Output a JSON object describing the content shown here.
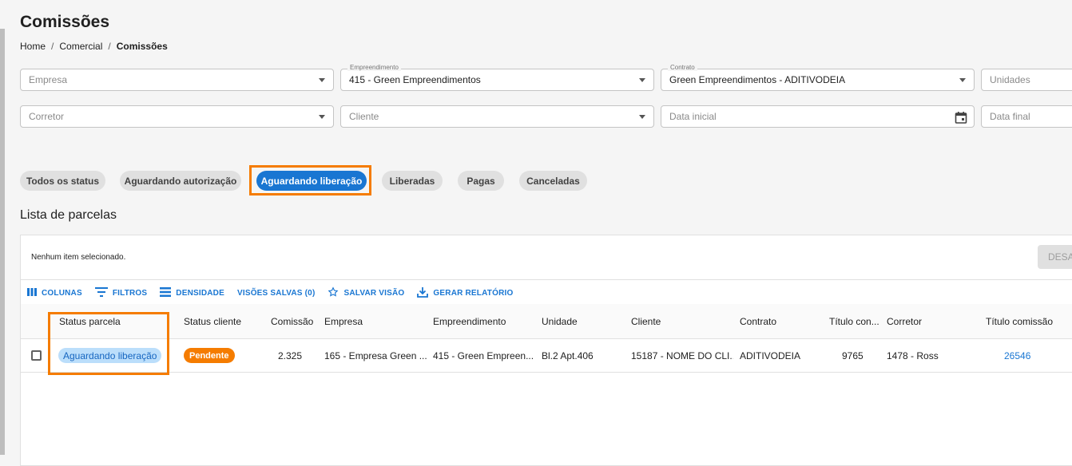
{
  "page": {
    "title": "Comissões"
  },
  "breadcrumb": {
    "home": "Home",
    "comercial": "Comercial",
    "current": "Comissões",
    "sep": "/"
  },
  "filters": {
    "empresa": {
      "placeholder": "Empresa",
      "value": ""
    },
    "empreendimento": {
      "label": "Empreendimento",
      "value": "415 - Green Empreendimentos"
    },
    "contrato": {
      "label": "Contrato",
      "value": "Green Empreendimentos - ADITIVODEIA"
    },
    "unidades": {
      "placeholder": "Unidades"
    },
    "corretor": {
      "placeholder": "Corretor"
    },
    "cliente": {
      "placeholder": "Cliente"
    },
    "data_inicial": {
      "placeholder": "Data inicial"
    },
    "data_final": {
      "placeholder": "Data final"
    }
  },
  "status_chips": [
    {
      "label": "Todos os status",
      "active": false
    },
    {
      "label": "Aguardando autorização",
      "active": false
    },
    {
      "label": "Aguardando liberação",
      "active": true
    },
    {
      "label": "Liberadas",
      "active": false
    },
    {
      "label": "Pagas",
      "active": false
    },
    {
      "label": "Canceladas",
      "active": false
    }
  ],
  "list": {
    "title": "Lista de parcelas",
    "selection_text": "Nenhum item selecionado.",
    "desab_button": "DESAB"
  },
  "toolbar": {
    "colunas": "COLUNAS",
    "filtros": "FILTROS",
    "densidade": "DENSIDADE",
    "visoes": "VISÕES SALVAS (0)",
    "salvar": "SALVAR VISÃO",
    "relatorio": "GERAR RELATÓRIO"
  },
  "table": {
    "columns": [
      "Status parcela",
      "Status cliente",
      "Comissão",
      "Empresa",
      "Empreendimento",
      "Unidade",
      "Cliente",
      "Contrato",
      "Título con...",
      "Corretor",
      "Título comissão"
    ],
    "rows": [
      {
        "status_parcela": "Aguardando liberação",
        "status_cliente": "Pendente",
        "comissao": "2.325",
        "empresa": "165 - Empresa Green ...",
        "empreendimento": "415 - Green Empreen...",
        "unidade": "Bl.2 Apt.406",
        "cliente": "15187 - NOME DO CLI...",
        "contrato": "ADITIVODEIA",
        "titulo_con": "9765",
        "corretor": "1478 - Ross",
        "titulo_comissao": "26546"
      }
    ]
  },
  "colors": {
    "accent": "#1976d2",
    "highlight": "#f57c00",
    "badge_blue_bg": "#bbdefb",
    "badge_orange": "#f57c00"
  }
}
